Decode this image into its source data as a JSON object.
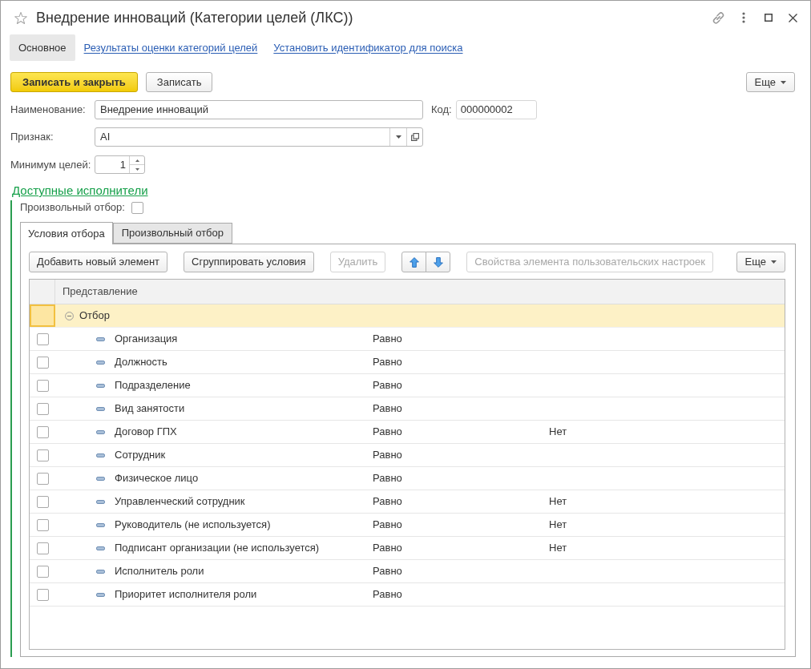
{
  "window": {
    "title": "Внедрение инноваций (Категории целей (ЛКС))",
    "favorite": false
  },
  "nav": [
    {
      "label": "Основное",
      "selected": true
    },
    {
      "label": "Результаты оценки категорий целей",
      "selected": false
    },
    {
      "label": "Установить идентификатор для поиска",
      "selected": false
    }
  ],
  "command_bar": {
    "buttons": [
      {
        "label": "Записать и закрыть",
        "kind": "primary"
      },
      {
        "label": "Записать",
        "kind": "default"
      }
    ],
    "more": "Еще"
  },
  "form": {
    "name": {
      "label": "Наименование:",
      "value": "Внедрение инноваций"
    },
    "code": {
      "label": "Код:",
      "value": "000000002"
    },
    "attribute": {
      "label": "Признак:",
      "value": "AI"
    },
    "min_goals": {
      "label": "Минимум целей:",
      "value": "1"
    }
  },
  "performers": {
    "title": "Доступные исполнители",
    "custom_filter": {
      "label": "Произвольный отбор:",
      "checked": false
    },
    "tabs": [
      {
        "label": "Условия отбора",
        "selected": true
      },
      {
        "label": "Произвольный отбор",
        "selected": false
      }
    ],
    "toolbar": [
      {
        "kind": "button",
        "label": "Добавить новый элемент",
        "disabled": false
      },
      {
        "kind": "button",
        "label": "Сгруппировать условия",
        "disabled": false
      },
      {
        "kind": "button",
        "label": "Удалить",
        "disabled": true
      },
      {
        "kind": "move"
      },
      {
        "kind": "button",
        "label": "Свойства элемента пользовательских настроек",
        "disabled": true
      },
      {
        "kind": "menu",
        "label": "Еще"
      }
    ],
    "table": {
      "columns": [
        "Представление"
      ],
      "group": {
        "label": "Отбор",
        "expanded": true,
        "selected": true
      },
      "rows": [
        {
          "checked": false,
          "name": "Организация",
          "condition": "Равно"
        },
        {
          "checked": false,
          "name": "Должность",
          "condition": "Равно"
        },
        {
          "checked": false,
          "name": "Подразделение",
          "condition": "Равно"
        },
        {
          "checked": false,
          "name": "Вид занятости",
          "condition": "Равно"
        },
        {
          "checked": false,
          "name": "Договор ГПХ",
          "condition": "Равно",
          "value": "Нет"
        },
        {
          "checked": false,
          "name": "Сотрудник",
          "condition": "Равно"
        },
        {
          "checked": false,
          "name": "Физическое лицо",
          "condition": "Равно"
        },
        {
          "checked": false,
          "name": "Управленческий сотрудник",
          "condition": "Равно",
          "value": "Нет"
        },
        {
          "checked": false,
          "name": "Руководитель (не используется)",
          "condition": "Равно",
          "value": "Нет"
        },
        {
          "checked": false,
          "name": "Подписант организации (не используется)",
          "condition": "Равно",
          "value": "Нет"
        },
        {
          "checked": false,
          "name": "Исполнитель роли",
          "condition": "Равно"
        },
        {
          "checked": false,
          "name": "Приоритет исполнителя роли",
          "condition": "Равно"
        }
      ]
    }
  }
}
